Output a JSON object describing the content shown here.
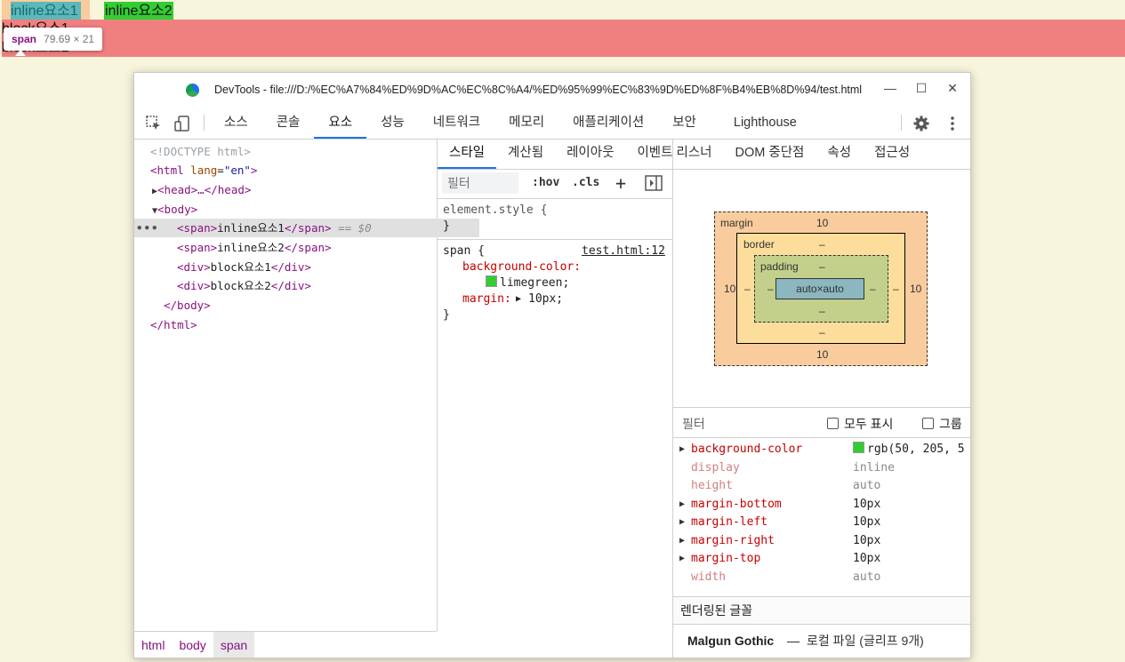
{
  "page": {
    "span1_text": "inline요소1",
    "span2_text": "inline요소2",
    "block1_text": "block요소1",
    "block2_text": "block요소2"
  },
  "tooltip": {
    "tag": "span",
    "size": "79.69 × 21"
  },
  "window": {
    "title": "DevTools - file:///D:/%EC%A7%84%ED%9D%AC%EC%8C%A4/%ED%95%99%EC%83%9D%ED%8F%B4%EB%8D%94/test.html",
    "minimize": "—",
    "maximize": "☐",
    "close": "✕"
  },
  "toolbar": {
    "tabs": [
      "소스",
      "콘솔",
      "요소",
      "성능",
      "네트워크",
      "메모리",
      "애플리케이션",
      "보안",
      "Lighthouse"
    ],
    "active_tab": "요소"
  },
  "elements": {
    "doctype": "<!DOCTYPE html>",
    "html_open": "<html",
    "html_attr": "lang",
    "html_attr_val": "\"en\"",
    "head": "<head>…</head>",
    "body_open": "<body>",
    "span1_open": "<span>",
    "span1_text": "inline요소1",
    "span_close": "</span>",
    "selected_marker": "== $0",
    "span2_text": "inline요소2",
    "div_open": "<div>",
    "div1_text": "block요소1",
    "div_close": "</div>",
    "div2_text": "block요소2",
    "body_close": "</body>",
    "html_close": "</html>"
  },
  "breadcrumbs": [
    "html",
    "body",
    "span"
  ],
  "subtabs": [
    "스타일",
    "계산됨",
    "레이아웃",
    "이벤트 리스너",
    "DOM 중단점",
    "속성",
    "접근성"
  ],
  "styles": {
    "filter_placeholder": "필터",
    "hov": ":hov",
    "cls": ".cls",
    "plus": "+",
    "element_style": "element.style {",
    "close_brace": "}",
    "span_selector": "span {",
    "source_link": "test.html:12",
    "prop1": "background-color:",
    "val1": "limegreen;",
    "prop2": "margin:",
    "val2": "10px;"
  },
  "box_model": {
    "margin_label": "margin",
    "border_label": "border",
    "padding_label": "padding",
    "margin_top": "10",
    "margin_bottom": "10",
    "margin_left": "10",
    "margin_right": "10",
    "border_top": "–",
    "border_bottom": "–",
    "border_left": "–",
    "border_right": "–",
    "padding_top": "–",
    "padding_bottom": "–",
    "padding_left": "–",
    "padding_right": "–",
    "content": "auto×auto"
  },
  "computed": {
    "filter_label": "필터",
    "show_all": "모두 표시",
    "group": "그룹",
    "rows": [
      {
        "prop": "background-color",
        "value": "rgb(50, 205, 5",
        "expandable": true
      },
      {
        "prop": "display",
        "value": "inline",
        "expandable": false
      },
      {
        "prop": "height",
        "value": "auto",
        "expandable": false
      },
      {
        "prop": "margin-bottom",
        "value": "10px",
        "expandable": true
      },
      {
        "prop": "margin-left",
        "value": "10px",
        "expandable": true
      },
      {
        "prop": "margin-right",
        "value": "10px",
        "expandable": true
      },
      {
        "prop": "margin-top",
        "value": "10px",
        "expandable": true
      },
      {
        "prop": "width",
        "value": "auto",
        "expandable": false
      }
    ],
    "rendered_fonts_label": "렌더링된 글꼴",
    "font_name": "Malgun Gothic",
    "font_dash": "—",
    "font_detail": "로컬 파일 (글리프 9개)"
  },
  "colors": {
    "limegreen": "#32cd32",
    "lightcoral": "#f08080",
    "accent": "#1a73e8"
  }
}
